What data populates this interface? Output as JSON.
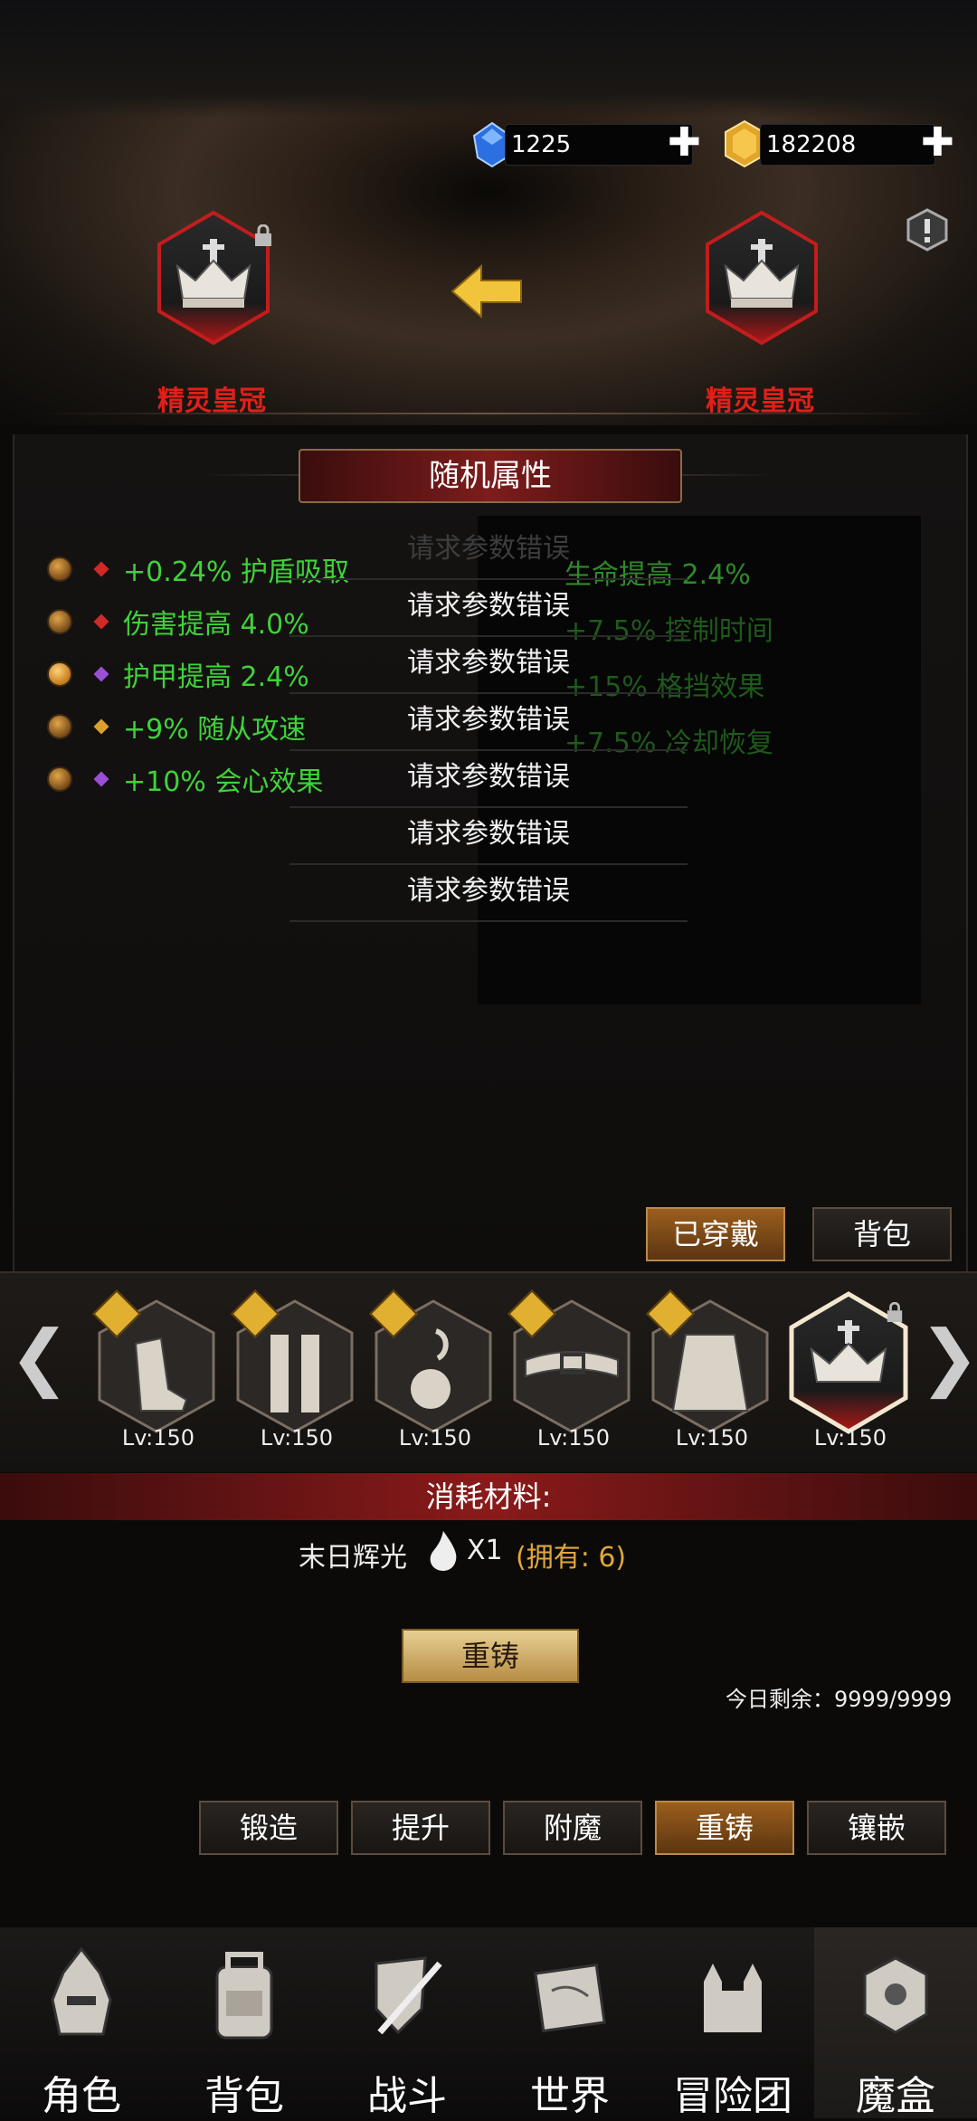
{
  "currency": {
    "gem_value": "1225",
    "gold_value": "182208"
  },
  "reforge": {
    "left_item_name": "精灵皇冠",
    "right_item_name": "精灵皇冠"
  },
  "section_title": "随机属性",
  "stats": [
    {
      "text": "+0.24% 护盾吸取",
      "gem_color": "#d12828"
    },
    {
      "text": "伤害提高 4.0%",
      "gem_color": "#d12828"
    },
    {
      "text": "护甲提高 2.4%",
      "gem_color": "#9a4fd6"
    },
    {
      "text": "+9% 随从攻速",
      "gem_color": "#d9a12c"
    },
    {
      "text": "+10% 会心效果",
      "gem_color": "#9a4fd6"
    }
  ],
  "right_stats": [
    {
      "text": "生命提高 2.4%"
    },
    {
      "text": "+7.5% 控制时间"
    },
    {
      "text": "+15% 格挡效果"
    },
    {
      "text": "+7.5% 冷却恢复"
    }
  ],
  "errors": [
    "请求参数错误",
    "请求参数错误",
    "请求参数错误",
    "请求参数错误",
    "请求参数错误",
    "请求参数错误",
    "请求参数错误"
  ],
  "buttons": {
    "equipped": "已穿戴",
    "bag": "背包",
    "reforge": "重铸"
  },
  "equipment": [
    {
      "icon": "boots-icon",
      "level": "Lv:150"
    },
    {
      "icon": "leggings-icon",
      "level": "Lv:150"
    },
    {
      "icon": "amulet-icon",
      "level": "Lv:150"
    },
    {
      "icon": "belt-icon",
      "level": "Lv:150"
    },
    {
      "icon": "cloak-icon",
      "level": "Lv:150"
    },
    {
      "icon": "crown-icon",
      "level": "Lv:150"
    }
  ],
  "materials": {
    "header": "消耗材料:",
    "name": "末日辉光",
    "qty": "X1",
    "owned": "(拥有: 6)"
  },
  "remaining_today": "今日剩余：9999/9999",
  "tabs": [
    "锻造",
    "提升",
    "附魔",
    "重铸",
    "镶嵌"
  ],
  "active_tab_index": 3,
  "nav": [
    "角色",
    "背包",
    "战斗",
    "世界",
    "冒险团",
    "魔盒"
  ],
  "active_nav_index": 5
}
